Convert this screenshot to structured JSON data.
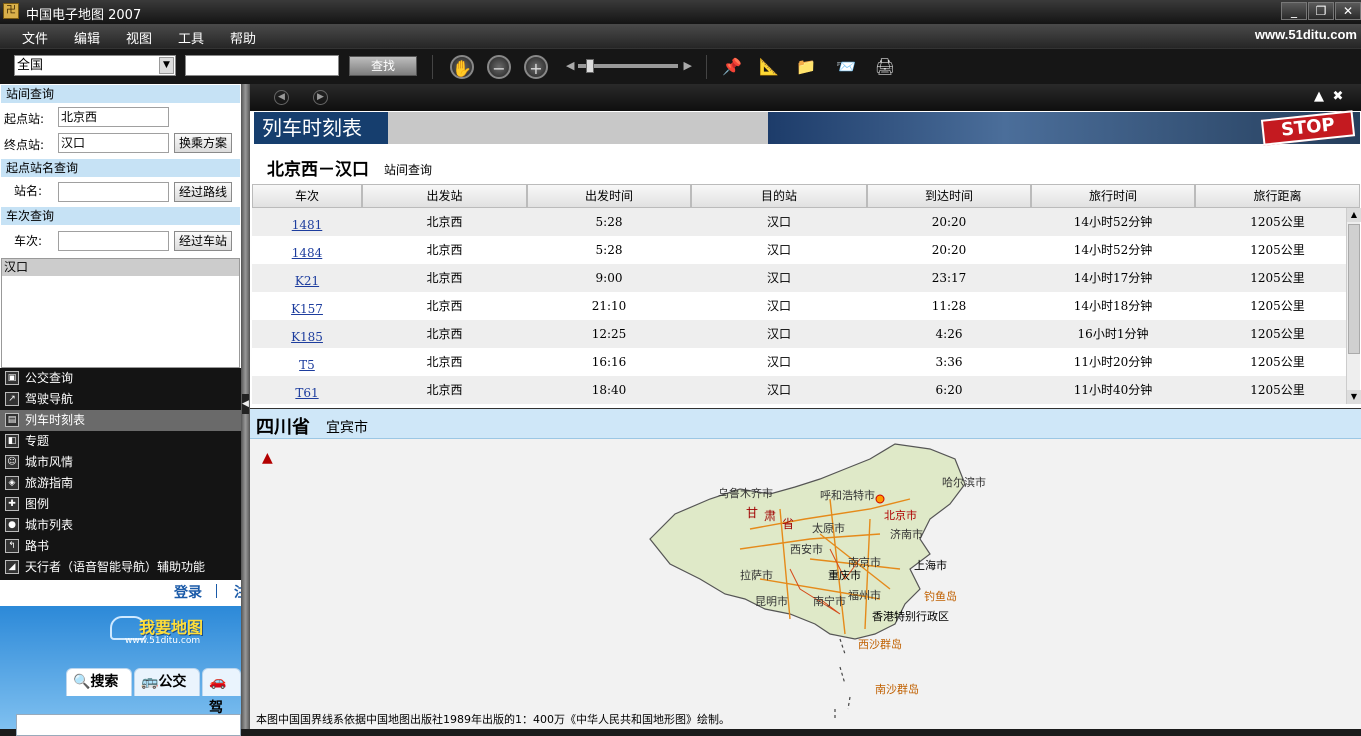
{
  "window": {
    "title": "中国电子地图 2007",
    "site": "www.51ditu.com"
  },
  "menu": [
    "文件",
    "编辑",
    "视图",
    "工具",
    "帮助"
  ],
  "toolbar": {
    "region_value": "全国",
    "search_value": "",
    "find_label": "查找",
    "icons": [
      "hand-pan-icon",
      "zoom-out-icon",
      "zoom-in-icon",
      "pin-icon",
      "ruler-icon",
      "folder-icon",
      "send-icon",
      "print-icon"
    ]
  },
  "left": {
    "station_query": {
      "header": "站间查询",
      "from_label": "起点站:",
      "from_value": "北京西",
      "to_label": "终点站:",
      "to_value": "汉口",
      "transfer_btn": "换乘方案"
    },
    "start_station": {
      "header": "起点站名查询",
      "name_label": "站名:",
      "name_value": "",
      "route_btn": "经过路线"
    },
    "train_query": {
      "header": "车次查询",
      "train_label": "车次:",
      "train_value": "",
      "station_btn": "经过车站"
    },
    "result_header": "汉口",
    "nav": [
      {
        "label": "公交查询",
        "icon": "bus-icon"
      },
      {
        "label": "驾驶导航",
        "icon": "navigation-icon"
      },
      {
        "label": "列车时刻表",
        "icon": "train-schedule-icon",
        "active": true
      },
      {
        "label": "专题",
        "icon": "topic-icon"
      },
      {
        "label": "城市风情",
        "icon": "city-scene-icon"
      },
      {
        "label": "旅游指南",
        "icon": "travel-guide-icon"
      },
      {
        "label": "图例",
        "icon": "legend-icon"
      },
      {
        "label": "城市列表",
        "icon": "city-list-icon"
      },
      {
        "label": "路书",
        "icon": "roadbook-icon"
      },
      {
        "label": "天行者（语音智能导航）辅助功能",
        "icon": "voice-nav-icon"
      }
    ],
    "ad": {
      "login": "登录",
      "logo": "我要地图",
      "logo_url": "www.51ditu.com",
      "tabs": [
        "搜索",
        "公交",
        "驾"
      ]
    }
  },
  "schedule": {
    "banner_title": "列车时刻表",
    "stop_sign": "STOP",
    "route_title": "北京西－汉口",
    "route_sub": "站间查询",
    "columns": [
      "车次",
      "出发站",
      "出发时间",
      "目的站",
      "到达时间",
      "旅行时间",
      "旅行距离"
    ],
    "rows": [
      [
        "1481",
        "北京西",
        "5:28",
        "汉口",
        "20:20",
        "14小时52分钟",
        "1205公里"
      ],
      [
        "1484",
        "北京西",
        "5:28",
        "汉口",
        "20:20",
        "14小时52分钟",
        "1205公里"
      ],
      [
        "K21",
        "北京西",
        "9:00",
        "汉口",
        "23:17",
        "14小时17分钟",
        "1205公里"
      ],
      [
        "K157",
        "北京西",
        "21:10",
        "汉口",
        "11:28",
        "14小时18分钟",
        "1205公里"
      ],
      [
        "K185",
        "北京西",
        "12:25",
        "汉口",
        "4:26",
        "16小时1分钟",
        "1205公里"
      ],
      [
        "T5",
        "北京西",
        "16:16",
        "汉口",
        "3:36",
        "11小时20分钟",
        "1205公里"
      ],
      [
        "T61",
        "北京西",
        "18:40",
        "汉口",
        "6:20",
        "11小时40分钟",
        "1205公里"
      ]
    ]
  },
  "map": {
    "province": "四川省",
    "city": "宜宾市",
    "labels": [
      "乌鲁木齐市",
      "呼和浩特市",
      "哈尔滨市",
      "甘",
      "肃",
      "省",
      "北京市",
      "太原市",
      "济南市",
      "西安市",
      "南京市",
      "上海市",
      "拉萨市",
      "重庆市",
      "昆明市",
      "南宁市",
      "福州市",
      "钓鱼岛",
      "香港特别行政区",
      "西沙群岛",
      "南沙群岛"
    ],
    "footnote": "本图中国国界线系依据中国地图出版社1989年出版的1：400万《中华人民共和国地形图》绘制。"
  }
}
